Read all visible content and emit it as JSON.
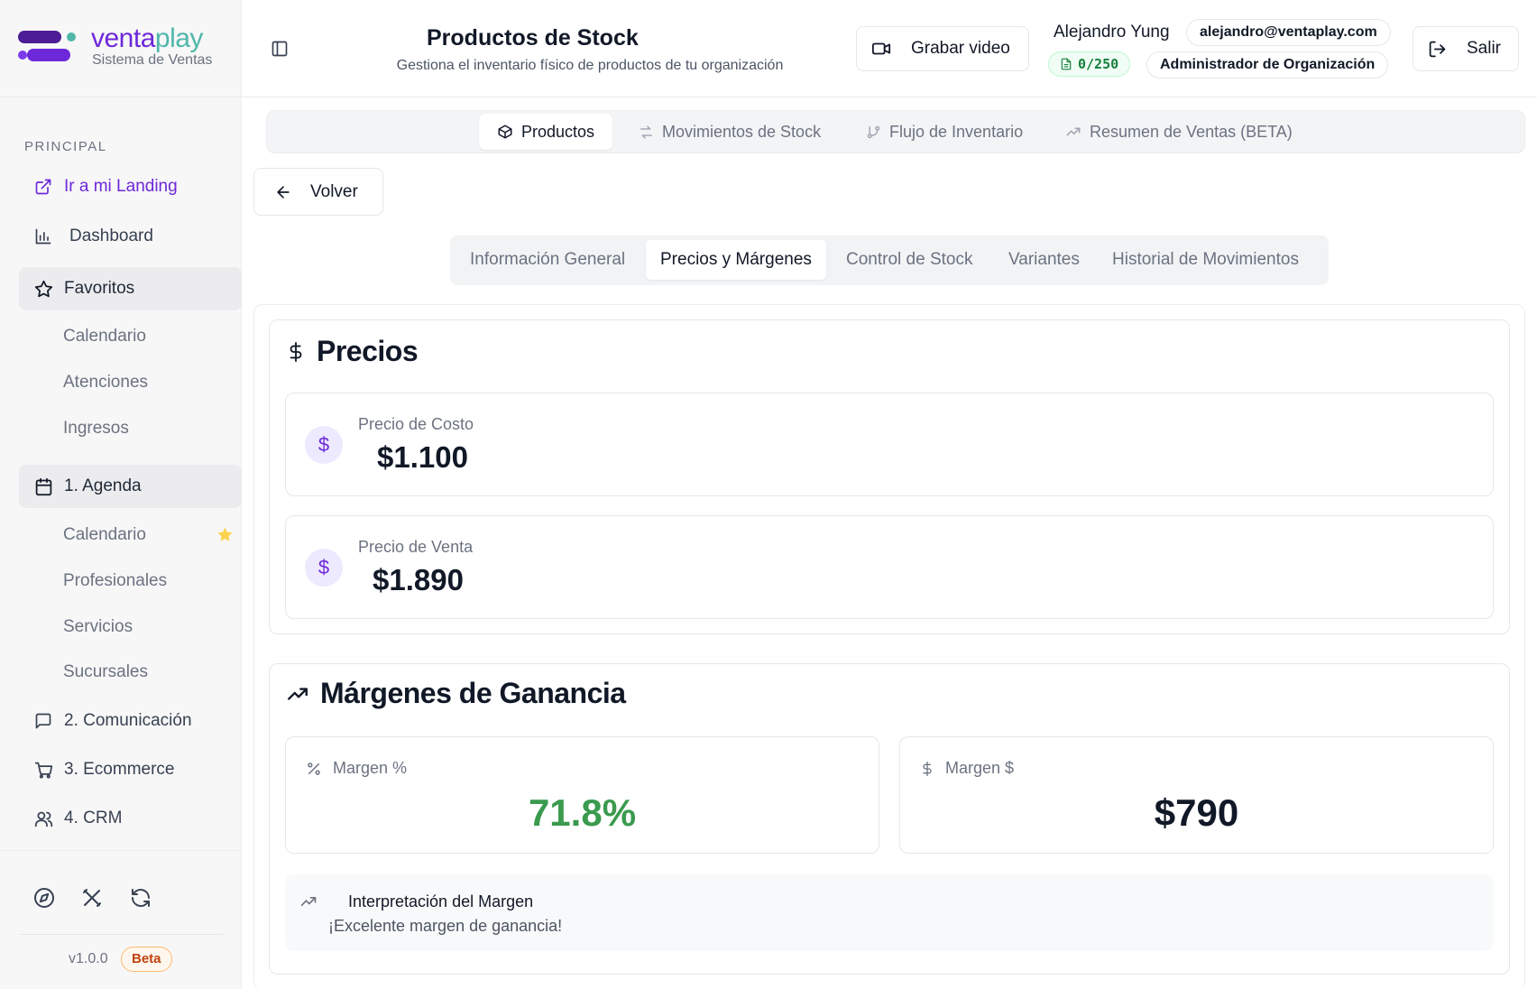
{
  "brand": {
    "name_part1": "venta",
    "name_part2": "play",
    "subtitle": "Sistema de Ventas",
    "primary_color": "#6d28d9",
    "secondary_color": "#4fb6a8"
  },
  "sidebar": {
    "section": "PRINCIPAL",
    "landing": "Ir a mi Landing",
    "dashboard": "Dashboard",
    "favorites": {
      "label": "Favoritos",
      "items": [
        "Calendario",
        "Atenciones",
        "Ingresos"
      ]
    },
    "agenda": {
      "label": "1. Agenda",
      "items": [
        "Calendario",
        "Profesionales",
        "Servicios",
        "Sucursales"
      ]
    },
    "comunicacion": "2. Comunicación",
    "ecommerce": "3. Ecommerce",
    "crm": "4. CRM",
    "version": "v1.0.0",
    "badge": "Beta"
  },
  "header": {
    "title": "Productos de Stock",
    "subtitle": "Gestiona el inventario físico de productos de tu organización",
    "record_button": "Grabar video",
    "user_name": "Alejandro Yung",
    "email": "alejandro@ventaplay.com",
    "counter": "0/250",
    "role": "Administrador de Organización",
    "exit_button": "Salir"
  },
  "top_tabs": [
    "Productos",
    "Movimientos de Stock",
    "Flujo de Inventario",
    "Resumen de Ventas (BETA)"
  ],
  "back_button": "Volver",
  "sub_tabs": [
    "Información General",
    "Precios y Márgenes",
    "Control de Stock",
    "Variantes",
    "Historial de Movimientos"
  ],
  "precios": {
    "title": "Precios",
    "cost_label": "Precio de Costo",
    "cost_value": "$1.100",
    "sale_label": "Precio de Venta",
    "sale_value": "$1.890"
  },
  "margenes": {
    "title": "Márgenes de Ganancia",
    "percent_label": "Margen %",
    "percent_value": "71.8%",
    "percent_color": "#3a9a4e",
    "amount_label": "Margen $",
    "amount_value": "$790",
    "interpretation_title": "Interpretación del Margen",
    "interpretation_text": "¡Excelente margen de ganancia!"
  }
}
